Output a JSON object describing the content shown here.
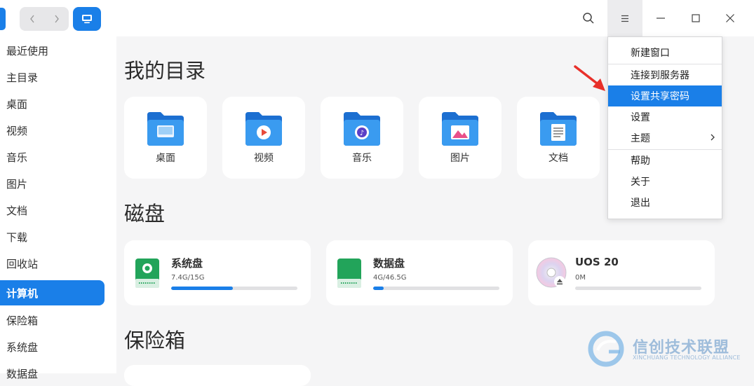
{
  "sidebar": {
    "items": [
      {
        "label": "最近使用"
      },
      {
        "label": "主目录"
      },
      {
        "label": "桌面"
      },
      {
        "label": "视频"
      },
      {
        "label": "音乐"
      },
      {
        "label": "图片"
      },
      {
        "label": "文档"
      },
      {
        "label": "下载"
      },
      {
        "label": "回收站"
      },
      {
        "label": "计算机",
        "active": true
      },
      {
        "label": "保险箱"
      },
      {
        "label": "系统盘"
      },
      {
        "label": "数据盘"
      }
    ]
  },
  "main": {
    "my_dirs_title": "我的目录",
    "dirs": [
      {
        "label": "桌面",
        "icon": "desktop-folder-icon"
      },
      {
        "label": "视频",
        "icon": "video-folder-icon"
      },
      {
        "label": "音乐",
        "icon": "music-folder-icon"
      },
      {
        "label": "图片",
        "icon": "pictures-folder-icon"
      },
      {
        "label": "文档",
        "icon": "documents-folder-icon"
      }
    ],
    "disks_title": "磁盘",
    "disks": [
      {
        "name": "系统盘",
        "size": "7.4G/15G",
        "usage_fraction": 0.49,
        "icon": "system-disk-icon"
      },
      {
        "name": "数据盘",
        "size": "4G/46.5G",
        "usage_fraction": 0.086,
        "icon": "data-disk-icon"
      },
      {
        "name": "UOS 20",
        "size": "0M",
        "usage_fraction": 0.0,
        "icon": "optical-disc-icon"
      }
    ],
    "vault_title": "保险箱"
  },
  "menu": {
    "items": [
      {
        "label": "新建窗口"
      },
      {
        "label": "连接到服务器"
      },
      {
        "label": "设置共享密码",
        "highlighted": true
      },
      {
        "label": "设置"
      },
      {
        "label": "主题",
        "has_submenu": true
      },
      {
        "label": "帮助"
      },
      {
        "label": "关于"
      },
      {
        "label": "退出"
      }
    ]
  },
  "watermark": {
    "text": "信创技术联盟",
    "subtext": "XINCHUANG TECHNOLOGY ALLIANCE"
  },
  "colors": {
    "accent": "#1a7fe8",
    "folder": "#2b8fe6",
    "arrow": "#e8302a"
  }
}
